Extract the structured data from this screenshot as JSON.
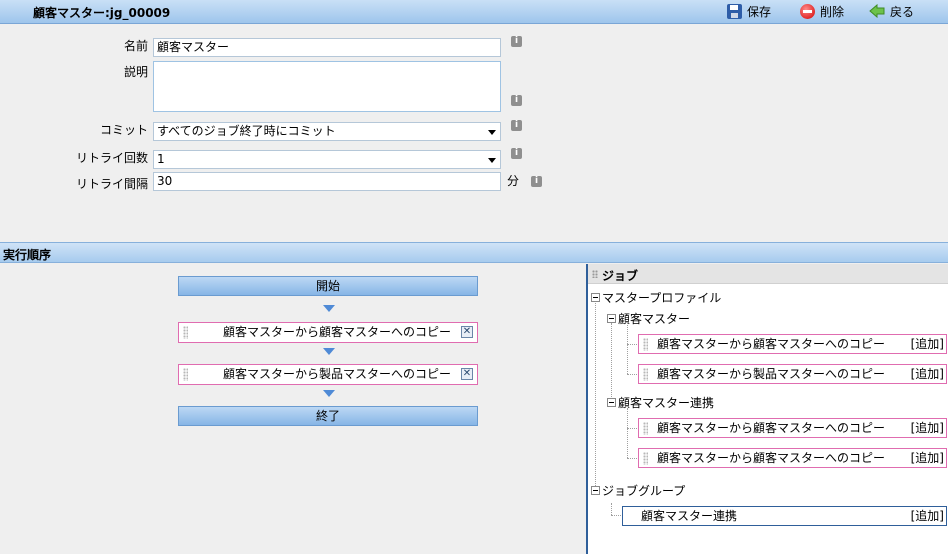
{
  "header": {
    "title": "顧客マスター:jg_00009",
    "save_label": "保存",
    "delete_label": "削除",
    "back_label": "戻る"
  },
  "form": {
    "name_label": "名前",
    "name_value": "顧客マスター",
    "description_label": "説明",
    "description_value": "",
    "commit_label": "コミット",
    "commit_value": "すべてのジョブ終了時にコミット",
    "retry_count_label": "リトライ回数",
    "retry_count_value": "1",
    "retry_interval_label": "リトライ間隔",
    "retry_interval_value": "30",
    "retry_interval_unit": "分"
  },
  "order": {
    "section_title": "実行順序",
    "start_label": "開始",
    "end_label": "終了",
    "steps": [
      "顧客マスターから顧客マスターへのコピー",
      "顧客マスターから製品マスターへのコピー"
    ]
  },
  "jobs_tree": {
    "title": "ジョブ",
    "add_label": "[追加]",
    "profile_folder": "マスタープロファイル",
    "folders": [
      {
        "name": "顧客マスター",
        "jobs": [
          "顧客マスターから顧客マスターへのコピー",
          "顧客マスターから製品マスターへのコピー"
        ]
      },
      {
        "name": "顧客マスター連携",
        "jobs": [
          "顧客マスターから顧客マスターへのコピー",
          "顧客マスターから顧客マスターへのコピー"
        ]
      }
    ],
    "group_folder": "ジョブグループ",
    "groups": [
      "顧客マスター連携"
    ]
  },
  "colors": {
    "header_blue": "#9ec5ec",
    "job_border_pink": "#e06cb0",
    "flow_blue": "#86b5e6",
    "divider_blue": "#2f5f9a"
  }
}
